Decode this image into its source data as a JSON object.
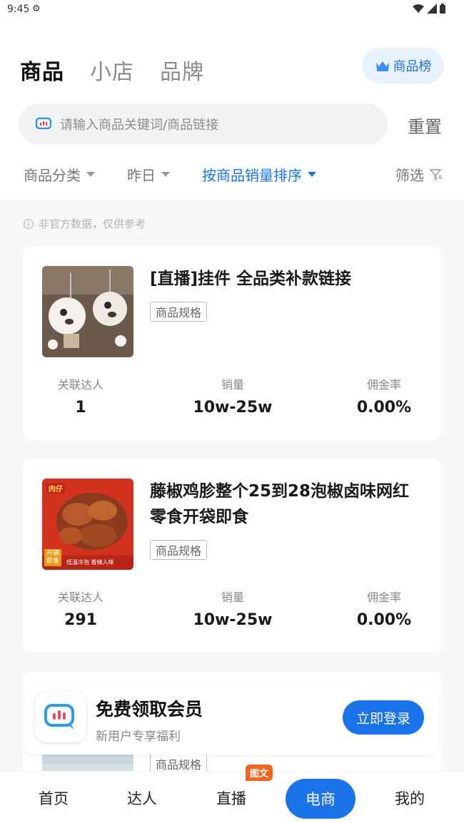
{
  "status": {
    "time": "9:45"
  },
  "tabs": [
    {
      "label": "商品"
    },
    {
      "label": "小店"
    },
    {
      "label": "品牌"
    }
  ],
  "rank_button": {
    "label": "商品榜"
  },
  "search": {
    "placeholder": "请输入商品关键词/商品链接",
    "reset_label": "重置"
  },
  "filters": {
    "category": "商品分类",
    "date": "昨日",
    "sort": "按商品销量排序",
    "filter": "筛选"
  },
  "notice": "非官方数据，仅供参考",
  "products": [
    {
      "title": "[直播]挂件 全品类补款链接",
      "spec": "商品规格",
      "stats": [
        {
          "label": "关联达人",
          "value": "1"
        },
        {
          "label": "销量",
          "value": "10w-25w"
        },
        {
          "label": "佣金率",
          "value": "0.00%"
        }
      ]
    },
    {
      "title": "藤椒鸡胗整个25到28泡椒卤味网红零食开袋即食",
      "spec": "商品规格",
      "image_text": {
        "brand": "肉仔",
        "tag": "开袋即食",
        "banner": "低温冷泡 香辣入味"
      },
      "stats": [
        {
          "label": "关联达人",
          "value": "291"
        },
        {
          "label": "销量",
          "value": "10w-25w"
        },
        {
          "label": "佣金率",
          "value": "0.00%"
        }
      ]
    },
    {
      "spec": "商品规格"
    }
  ],
  "promo": {
    "title": "免费领取会员",
    "subtitle": "新用户专享福利",
    "button": "立即登录"
  },
  "bottom_nav": {
    "items": [
      "首页",
      "达人",
      "直播",
      "电商",
      "我的"
    ],
    "active": "电商",
    "badge": "图文"
  },
  "colors": {
    "accent": "#1a73e8",
    "badge": "#f2641f"
  }
}
